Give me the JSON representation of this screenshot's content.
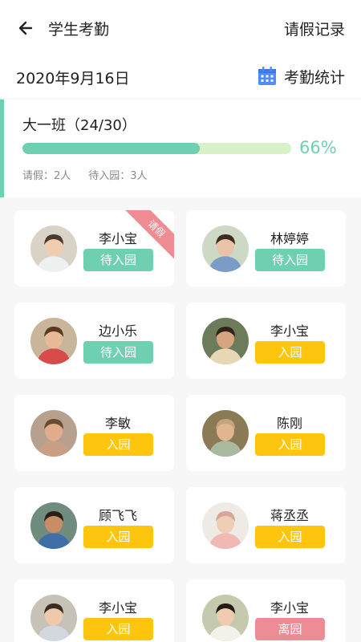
{
  "header": {
    "title": "学生考勤",
    "leave_records_label": "请假记录",
    "back_icon": "arrow-left-icon"
  },
  "date_bar": {
    "date": "2020年9月16日",
    "stats_label": "考勤统计",
    "stats_icon": "calendar-icon"
  },
  "class_summary": {
    "name": "大一班（24/30）",
    "progress_percent": 66,
    "progress_label": "66%",
    "leave_text": "请假：2人",
    "pending_text": "待入园：3人",
    "colors": {
      "accent": "#6fd0b1",
      "track": "#d7f2c6"
    }
  },
  "status_colors": {
    "pending": "#6fd0b1",
    "arrived": "#fdc50d",
    "departed": "#ec8c95"
  },
  "students": [
    {
      "name": "李小宝",
      "status": "待入园",
      "status_key": "pending",
      "ribbon": "请假"
    },
    {
      "name": "林婷婷",
      "status": "待入园",
      "status_key": "pending"
    },
    {
      "name": "边小乐",
      "status": "待入园",
      "status_key": "pending"
    },
    {
      "name": "李小宝",
      "status": "入园",
      "status_key": "arrived"
    },
    {
      "name": "李敏",
      "status": "入园",
      "status_key": "arrived"
    },
    {
      "name": "陈刚",
      "status": "入园",
      "status_key": "arrived"
    },
    {
      "name": "顾飞飞",
      "status": "入园",
      "status_key": "arrived"
    },
    {
      "name": "蒋丞丞",
      "status": "入园",
      "status_key": "arrived"
    },
    {
      "name": "李小宝",
      "status": "入园",
      "status_key": "arrived"
    },
    {
      "name": "李小宝",
      "status": "离园",
      "status_key": "departed"
    }
  ]
}
